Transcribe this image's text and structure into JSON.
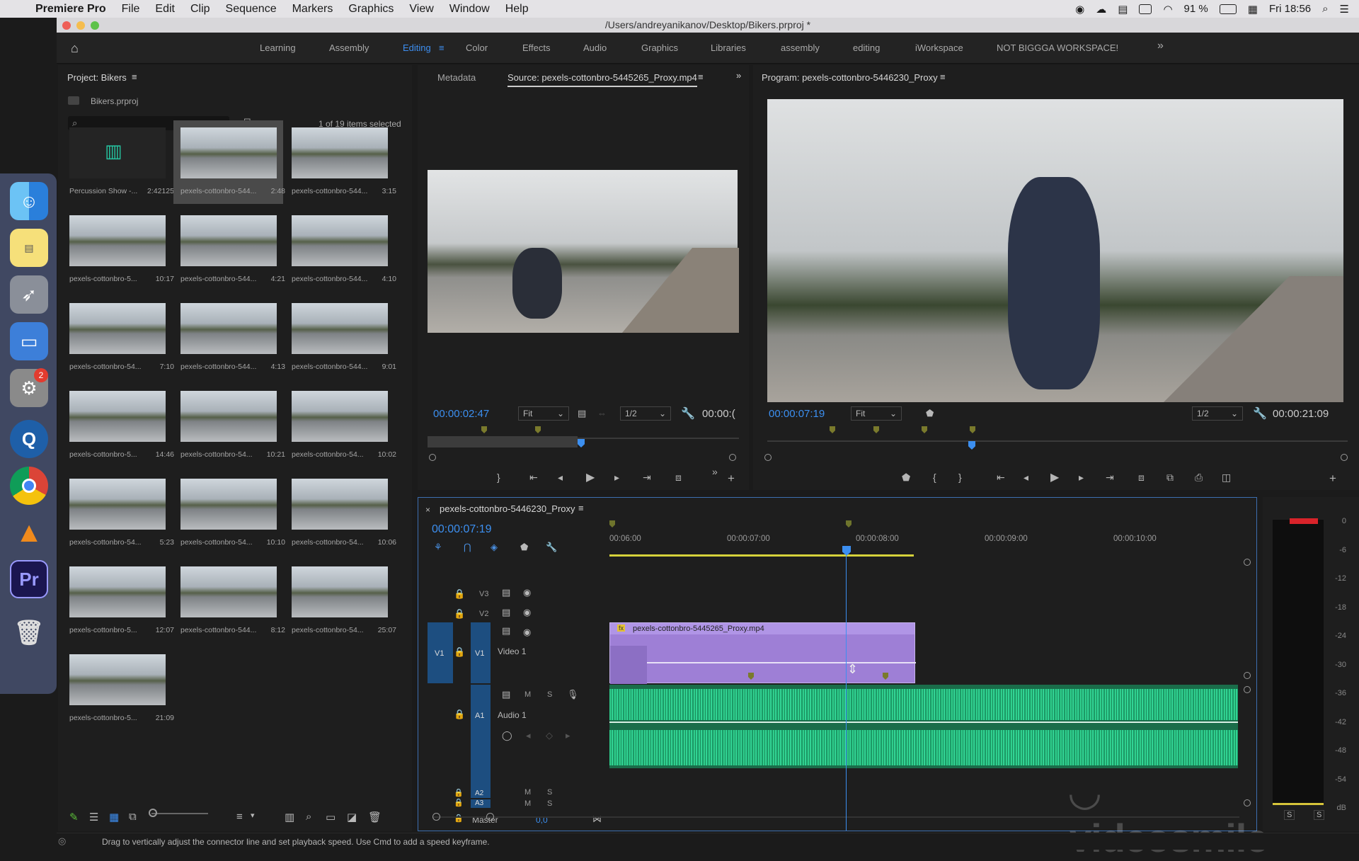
{
  "menubar": {
    "app": "Premiere Pro",
    "items": [
      "File",
      "Edit",
      "Clip",
      "Sequence",
      "Markers",
      "Graphics",
      "View",
      "Window",
      "Help"
    ],
    "battery": "91 %",
    "clock": "Fri 18:56"
  },
  "window": {
    "title": "/Users/andreyanikanov/Desktop/Bikers.prproj *"
  },
  "workspaces": {
    "items": [
      "Learning",
      "Assembly",
      "Editing",
      "Color",
      "Effects",
      "Audio",
      "Graphics",
      "Libraries",
      "assembly",
      "editing",
      "iWorkspace",
      "NOT BIGGGA WORKSPACE!"
    ],
    "active": "Editing",
    "overflow": "»"
  },
  "project": {
    "title": "Project: Bikers",
    "file": "Bikers.prproj",
    "search_placeholder": "",
    "selected_count": "1 of 19 items selected",
    "items": [
      {
        "name": "Percussion Show -...",
        "dur": "2:42125"
      },
      {
        "name": "pexels-cottonbro-544...",
        "dur": "2:48"
      },
      {
        "name": "pexels-cottonbro-544...",
        "dur": "3:15"
      },
      {
        "name": "pexels-cottonbro-5...",
        "dur": "10:17"
      },
      {
        "name": "pexels-cottonbro-544...",
        "dur": "4:21"
      },
      {
        "name": "pexels-cottonbro-544...",
        "dur": "4:10"
      },
      {
        "name": "pexels-cottonbro-54...",
        "dur": "7:10"
      },
      {
        "name": "pexels-cottonbro-544...",
        "dur": "4:13"
      },
      {
        "name": "pexels-cottonbro-544...",
        "dur": "9:01"
      },
      {
        "name": "pexels-cottonbro-5...",
        "dur": "14:46"
      },
      {
        "name": "pexels-cottonbro-54...",
        "dur": "10:21"
      },
      {
        "name": "pexels-cottonbro-54...",
        "dur": "10:02"
      },
      {
        "name": "pexels-cottonbro-54...",
        "dur": "5:23"
      },
      {
        "name": "pexels-cottonbro-54...",
        "dur": "10:10"
      },
      {
        "name": "pexels-cottonbro-54...",
        "dur": "10:06"
      },
      {
        "name": "pexels-cottonbro-5...",
        "dur": "12:07"
      },
      {
        "name": "pexels-cottonbro-544...",
        "dur": "8:12"
      },
      {
        "name": "pexels-cottonbro-54...",
        "dur": "25:07"
      },
      {
        "name": "pexels-cottonbro-5...",
        "dur": "21:09"
      }
    ]
  },
  "source": {
    "tab_metadata": "Metadata",
    "tab_source": "Source: pexels-cottonbro-5445265_Proxy.mp4",
    "timecode": "00:00:02:47",
    "fit": "Fit",
    "res": "1/2",
    "duration": "00:00:("
  },
  "program": {
    "title": "Program: pexels-cottonbro-5446230_Proxy",
    "timecode": "00:00:07:19",
    "fit": "Fit",
    "res": "1/2",
    "duration": "00:00:21:09"
  },
  "timeline": {
    "seq_name": "pexels-cottonbro-5446230_Proxy",
    "timecode": "00:00:07:19",
    "ticks": [
      "00:06:00",
      "00:00:07:00",
      "00:00:08:00",
      "00:00:09:00",
      "00:00:10:00"
    ],
    "tracks": {
      "v3": "V3",
      "v2": "V2",
      "v1": "V1",
      "v1_src": "V1",
      "video1": "Video 1",
      "a1": "A1",
      "audio1": "Audio 1",
      "a2": "A2",
      "a3": "A3",
      "master": "Master",
      "master_val": "0,0",
      "m": "M",
      "s": "S"
    },
    "clip": "pexels-cottonbro-5445265_Proxy.mp4",
    "fx": "fx"
  },
  "meters": {
    "labels": [
      "0",
      "-6",
      "-12",
      "-18",
      "-24",
      "-30",
      "-36",
      "-42",
      "-48",
      "-54",
      "dB"
    ],
    "solo": "S"
  },
  "watermark": "videosmile",
  "status": "Drag to vertically adjust the connector line and set playback speed. Use Cmd to add a speed keyframe.",
  "badges": {
    "settings": "2"
  }
}
